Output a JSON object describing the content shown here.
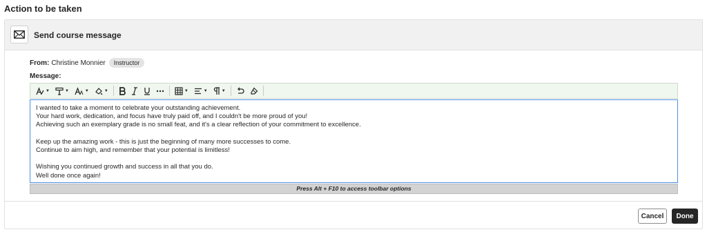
{
  "page": {
    "heading": "Action to be taken"
  },
  "panel": {
    "title": "Send course message",
    "icon": "envelope-icon",
    "from_label": "From:",
    "from_name": "Christine Monnier",
    "role_badge": "Instructor",
    "message_label": "Message:"
  },
  "toolbar": {
    "items": [
      "text-style-icon",
      "paragraph-format-icon",
      "font-size-icon",
      "text-color-icon",
      "bold-icon",
      "italic-icon",
      "underline-icon",
      "more-icon",
      "table-icon",
      "align-icon",
      "paragraph-icon",
      "undo-icon",
      "clear-format-icon"
    ]
  },
  "editor": {
    "lines": [
      "I wanted to take a moment to celebrate your outstanding achievement.",
      "Your hard work, dedication, and focus have truly paid off, and I couldn't be more proud of you!",
      "Achieving such an exemplary grade is no small feat, and it's a clear reflection of your commitment to excellence.",
      "",
      "Keep up the amazing work - this is just the beginning of many more successes to come.",
      "Continue to aim high, and remember that your potential is limitless!",
      "",
      "Wishing you continued growth and success in all that you do.",
      "Well done once again!"
    ]
  },
  "hint": "Press Alt + F10 to access toolbar options",
  "buttons": {
    "cancel": "Cancel",
    "done": "Done"
  },
  "colors": {
    "accent": "#4a90e2",
    "toolbar_bg": "#f0f7ee",
    "done_bg": "#262626",
    "header_bg": "#f1f1f1"
  }
}
